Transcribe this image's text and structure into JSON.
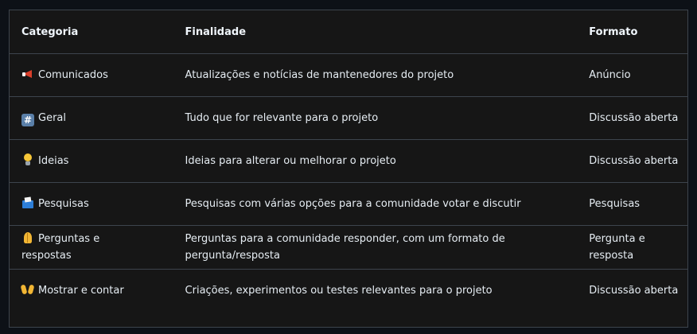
{
  "headers": {
    "category": "Categoria",
    "purpose": "Finalidade",
    "format": "Formato"
  },
  "rows": [
    {
      "icon": "megaphone-icon",
      "category": "Comunicados",
      "purpose": "Atualizações e notícias de mantenedores do projeto",
      "format": "Anúncio"
    },
    {
      "icon": "hash-keycap-icon",
      "icon_glyph": "#",
      "category": "Geral",
      "purpose": "Tudo que for relevante para o projeto",
      "format": "Discussão aberta"
    },
    {
      "icon": "light-bulb-icon",
      "category": "Ideias",
      "purpose": "Ideias para alterar ou melhorar o projeto",
      "format": "Discussão aberta"
    },
    {
      "icon": "ballot-box-icon",
      "category": "Pesquisas",
      "purpose": "Pesquisas com várias opções para a comunidade votar e discutir",
      "format": "Pesquisas"
    },
    {
      "icon": "folded-hands-icon",
      "category_line1": "Perguntas e",
      "category_line2": "respostas",
      "purpose_line1": "Perguntas para a comunidade responder, com um formato de",
      "purpose_line2": "pergunta/resposta",
      "format_line1": "Pergunta e",
      "format_line2": "resposta"
    },
    {
      "icon": "raised-hands-icon",
      "category": "Mostrar e contar",
      "purpose": "Criações, experimentos ou testes relevantes para o projeto",
      "format": "Discussão aberta"
    }
  ]
}
